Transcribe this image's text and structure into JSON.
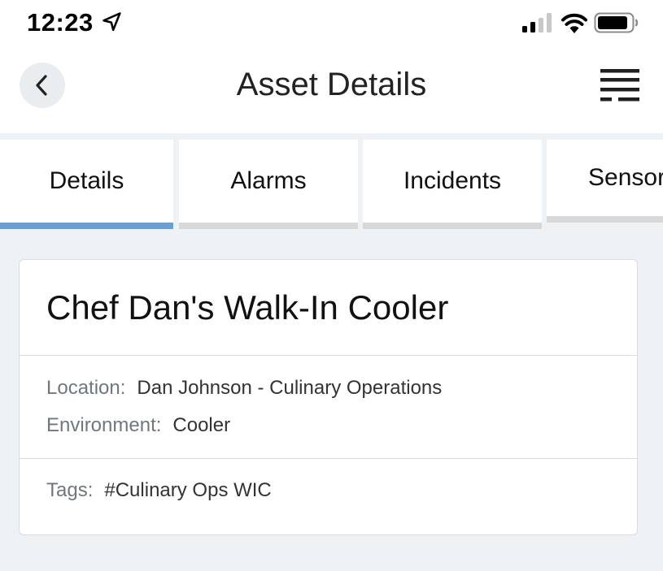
{
  "status_bar": {
    "time": "12:23",
    "icons": [
      "location-arrow-icon",
      "cellular-signal-icon",
      "wifi-icon",
      "battery-icon"
    ]
  },
  "header": {
    "title": "Asset Details",
    "back_icon": "chevron-left-icon",
    "menu_icon": "menu-icon"
  },
  "tabs": [
    {
      "label": "Details",
      "active": true
    },
    {
      "label": "Alarms",
      "active": false
    },
    {
      "label": "Incidents",
      "active": false
    },
    {
      "label": "Sensor",
      "active": false
    }
  ],
  "asset": {
    "name": "Chef Dan's Walk-In Cooler",
    "location_label": "Location:",
    "location_value": "Dan Johnson - Culinary Operations",
    "environment_label": "Environment:",
    "environment_value": "Cooler",
    "tags_label": "Tags:",
    "tags_value": "#Culinary Ops WIC"
  },
  "colors": {
    "background": "#eef2f5",
    "active_tab_indicator": "#6a9fd6",
    "inactive_tab_indicator": "#d8d8d8",
    "label_text": "#6f7780"
  }
}
